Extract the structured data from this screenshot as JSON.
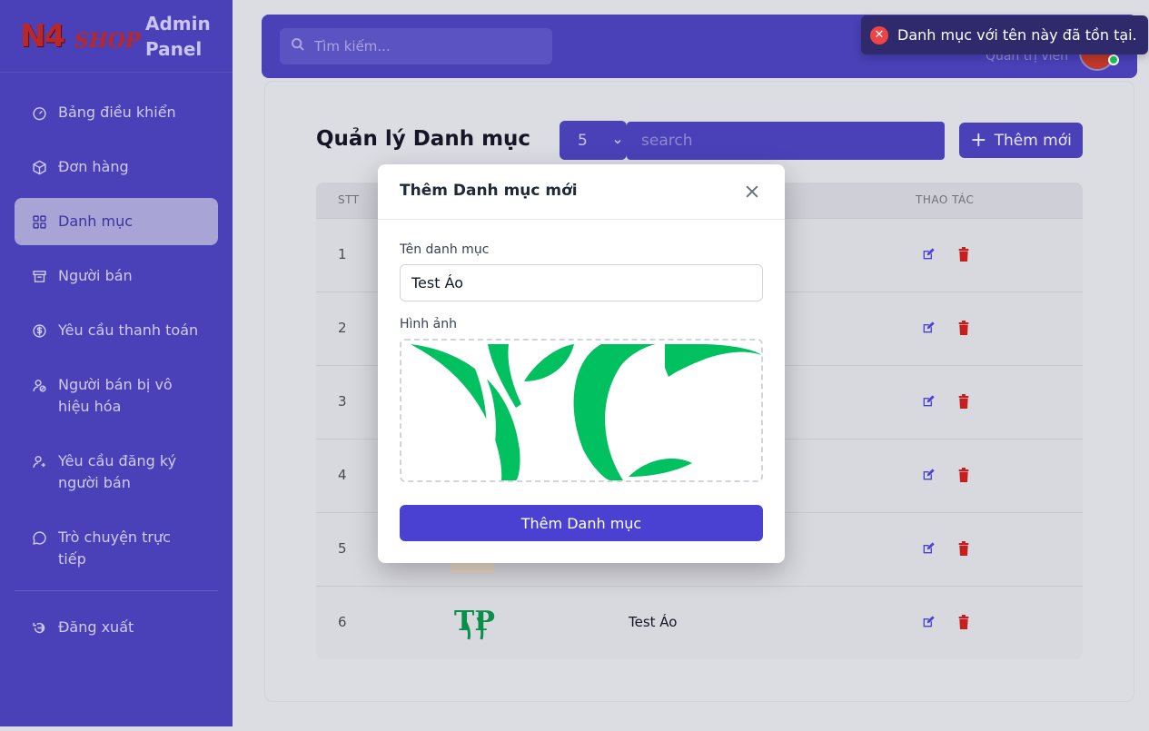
{
  "app": {
    "brand_logo_text_1": "N4",
    "brand_logo_text_2": "SHOP",
    "brand_title": "Admin Panel"
  },
  "sidebar": {
    "items": [
      {
        "label": "Bảng điều khiển",
        "icon": "gauge-icon"
      },
      {
        "label": "Đơn hàng",
        "icon": "package-icon"
      },
      {
        "label": "Danh mục",
        "icon": "grid-icon",
        "active": true
      },
      {
        "label": "Người bán",
        "icon": "store-icon"
      },
      {
        "label": "Yêu cầu thanh toán",
        "icon": "dollar-circle-icon"
      },
      {
        "label": "Người bán bị vô hiệu hóa",
        "icon": "user-block-icon"
      },
      {
        "label": "Yêu cầu đăng ký người bán",
        "icon": "user-plus-icon"
      },
      {
        "label": "Trò chuyện trực tiếp",
        "icon": "chat-icon"
      }
    ],
    "logout_label": "Đăng xuất"
  },
  "header": {
    "search_placeholder": "Tìm kiếm...",
    "role": "Quản trị viên"
  },
  "main": {
    "title": "Quản lý Danh mục",
    "per_page": "5",
    "search_placeholder": "search",
    "add_button": "Thêm mới",
    "table": {
      "headers": {
        "stt": "STT",
        "actions": "THAO TÁC"
      },
      "rows": [
        {
          "stt": "1",
          "name": ""
        },
        {
          "stt": "2",
          "name": ""
        },
        {
          "stt": "3",
          "name": ""
        },
        {
          "stt": "4",
          "name": ""
        },
        {
          "stt": "5",
          "name": ""
        },
        {
          "stt": "6",
          "name": "Test Áo"
        }
      ]
    }
  },
  "modal": {
    "title": "Thêm Danh mục mới",
    "name_label": "Tên danh mục",
    "name_value": "Test Áo",
    "image_label": "Hình ảnh",
    "submit": "Thêm Danh mục"
  },
  "toast": {
    "message": "Danh mục với tên này đã tồn tại."
  },
  "colors": {
    "sidebar": "#4a41b8",
    "primary": "#4a41d3",
    "error": "#ef4444",
    "leaf_green": "#00c060"
  }
}
